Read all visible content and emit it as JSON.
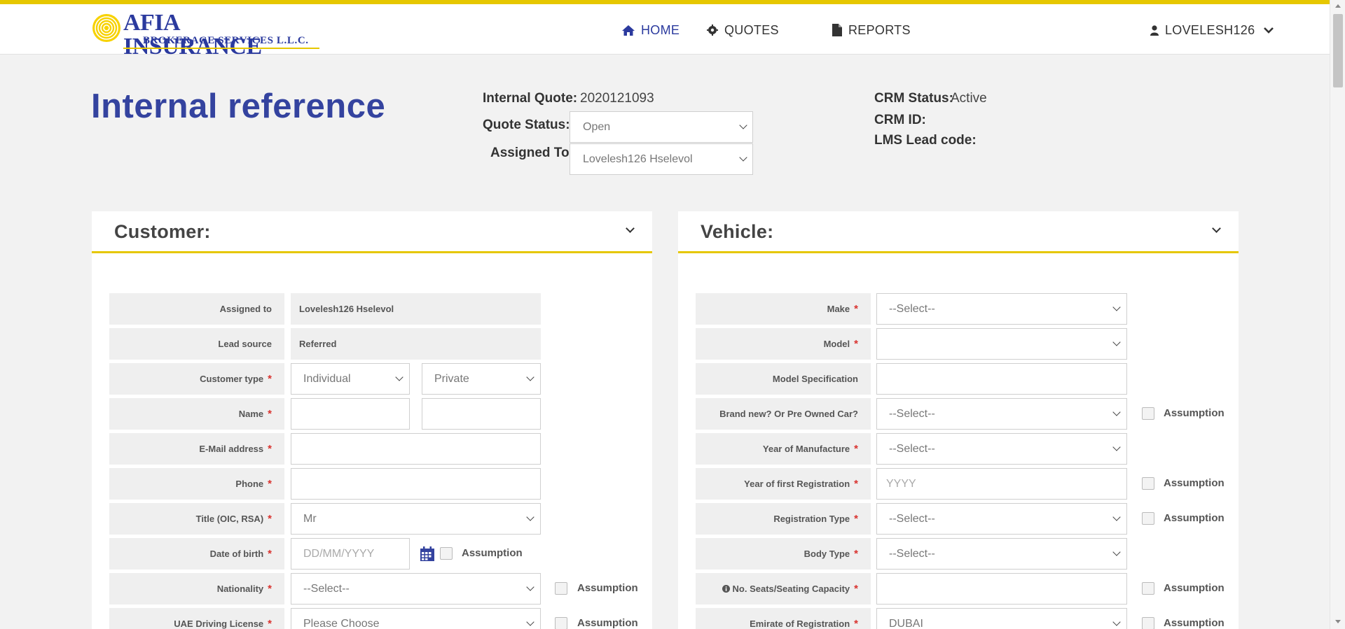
{
  "nav": {
    "logo_line1": "AFIA INSURANCE",
    "logo_line2": "BROKERAGE SERVICES L.L.C.",
    "home": "HOME",
    "quotes": "QUOTES",
    "reports": "REPORTS",
    "user": "LOVELESH126",
    "colors": {
      "accent": "#e6c700",
      "brand": "#2b3a9e"
    }
  },
  "header": {
    "title": "Internal reference",
    "internal_quote_label": "Internal Quote:",
    "internal_quote_value": "2020121093",
    "quote_status_label": "Quote Status:",
    "quote_status_value": "Open",
    "assigned_to_label": "Assigned To:",
    "assigned_to_value": "Lovelesh126 Hselevol",
    "crm_status_label": "CRM Status:",
    "crm_status_value": "Active",
    "crm_id_label": "CRM ID:",
    "lms_label": "LMS Lead code:"
  },
  "customer": {
    "title": "Customer:",
    "assigned_label": "Assigned to",
    "assigned_value": "Lovelesh126 Hselevol",
    "lead_label": "Lead source",
    "lead_value": "Referred",
    "type_label": "Customer type",
    "type_value": "Individual",
    "type2_value": "Private",
    "name_label": "Name",
    "email_label": "E-Mail address",
    "phone_label": "Phone",
    "title_label": "Title (OIC, RSA)",
    "title_value": "Mr",
    "dob_label": "Date of birth",
    "dob_placeholder": "DD/MM/YYYY",
    "nationality_label": "Nationality",
    "nationality_value": "--Select--",
    "license_label": "UAE Driving License",
    "license_value": "Please Choose",
    "assumption": "Assumption",
    "required": "*"
  },
  "vehicle": {
    "title": "Vehicle:",
    "make_label": "Make",
    "make_value": "--Select--",
    "model_label": "Model",
    "model_value": "",
    "spec_label": "Model Specification",
    "brand_label": "Brand new? Or Pre Owned Car?",
    "brand_value": "--Select--",
    "yom_label": "Year of Manufacture",
    "yom_value": "--Select--",
    "yofr_label": "Year of first Registration",
    "yofr_placeholder": "YYYY",
    "reg_type_label": "Registration Type",
    "reg_type_value": "--Select--",
    "body_label": "Body Type",
    "body_value": "--Select--",
    "seats_label": "No. Seats/Seating Capacity",
    "emirate_label": "Emirate of Registration",
    "emirate_value": "DUBAI",
    "assumption": "Assumption",
    "required": "*"
  }
}
